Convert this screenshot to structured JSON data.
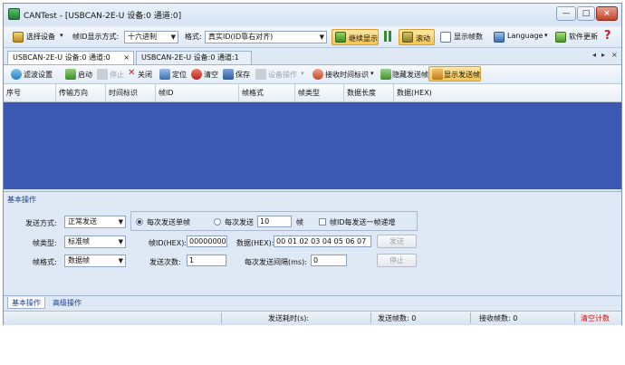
{
  "window": {
    "title": "CANTest - [USBCAN-2E-U 设备:0 通道:0]",
    "controls": [
      "—",
      "□",
      "×"
    ]
  },
  "toolbar": {
    "select_device": "选择设备",
    "frame_id_mode_label": "帧ID显示方式:",
    "frame_id_mode_value": "十六进制",
    "format_label": "格式:",
    "format_value": "真实ID(ID靠右对齐)",
    "continue_display": "继续显示",
    "pause_icon": "pause-icon",
    "scroll": "滚动",
    "show_frames": "显示帧数",
    "language": "Language",
    "software_update": "软件更新"
  },
  "tabs": [
    {
      "label": "USBCAN-2E-U 设备:0 通道:0",
      "close": "×"
    },
    {
      "label": "USBCAN-2E-U 设备:0 通道:1"
    }
  ],
  "tab_nav": [
    "◂",
    "▸",
    "×"
  ],
  "toolbar2": {
    "filter": "滤波设置",
    "start": "启动",
    "stop": "停止",
    "close": "关闭",
    "locate": "定位",
    "clear": "清空",
    "save": "保存",
    "device_ops": "设备操作",
    "recv_time_id": "接收时间标识",
    "hide_send": "隐藏发送帧",
    "show_send": "显示发送帧"
  },
  "grid": {
    "columns": [
      "序号",
      "传输方向",
      "时间标识",
      "帧ID",
      "帧格式",
      "帧类型",
      "数据长度",
      "数据(HEX)"
    ]
  },
  "panel": {
    "header": "基本操作",
    "send_mode_label": "发送方式:",
    "send_mode_value": "正常发送",
    "radio_single": "每次发送单帧",
    "radio_multi": "每次发送",
    "multi_count": "10",
    "multi_unit": "帧",
    "chk_increment": "帧ID每发送一帧递增",
    "frame_type_label": "帧类型:",
    "frame_type_value": "标准帧",
    "frame_id_label": "帧ID(HEX):",
    "frame_id_value": "00000000",
    "data_label": "数据(HEX):",
    "data_value": "00 01 02 03 04 05 06 07",
    "send_button": "发送",
    "frame_format_label": "帧格式:",
    "frame_format_value": "数据帧",
    "send_count_label": "发送次数:",
    "send_count_value": "1",
    "interval_label": "每次发送间隔(ms):",
    "interval_value": "0",
    "stop_button": "停止"
  },
  "bottom_tabs": [
    "基本操作",
    "高级操作"
  ],
  "status": {
    "elapsed": "发送耗时(s):",
    "sent_frames": "发送帧数: 0",
    "recv_frames": "接收帧数: 0",
    "clear_count": "清空计数"
  },
  "colors": {
    "grid_background": "#3b58b3",
    "chrome": "#dfe9f5",
    "clear_count_text": "#cc1111"
  }
}
